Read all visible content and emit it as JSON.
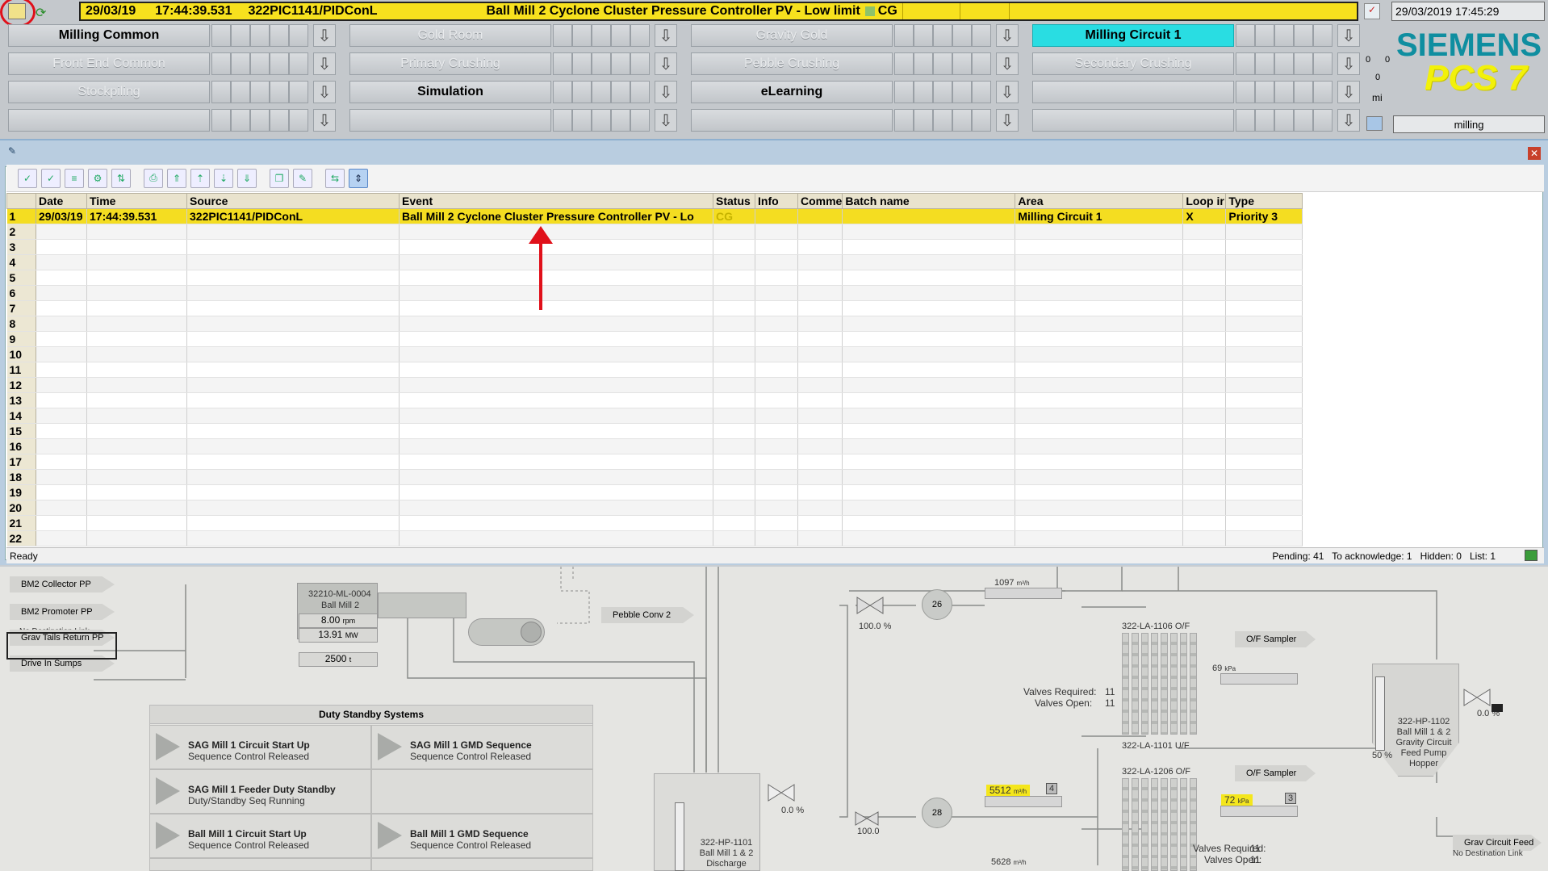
{
  "topbar": {
    "alarm": {
      "date": "29/03/19",
      "time": "17:44:39.531",
      "source": "322PIC1141/PIDConL",
      "event": "Ball Mill 2 Cyclone Cluster Pressure Controller PV - Low limit",
      "status": "CG"
    },
    "datetime": "29/03/2019 17:45:29",
    "area": "milling",
    "brand": "SIEMENS",
    "product": "PCS 7",
    "nav_row1": [
      "Milling Common",
      "Gold Room",
      "Gravity Gold",
      "Milling Circuit 1"
    ],
    "nav_row2": [
      "Front End Common",
      "Primary Crushing",
      "Pebble Crushing",
      "Secondary Crushing"
    ],
    "nav_row3": [
      "Stockpiling",
      "Simulation",
      "eLearning",
      ""
    ],
    "nav_row4": [
      "",
      "",
      "",
      ""
    ],
    "side_counts": {
      "a": "0",
      "b": "0",
      "c": "0",
      "d": "mi"
    }
  },
  "alarm_list": {
    "columns": [
      "Date",
      "Time",
      "Source",
      "Event",
      "Status",
      "Info",
      "Comme",
      "Batch name",
      "Area",
      "Loop ir",
      "Type"
    ],
    "rows": [
      {
        "n": "1",
        "date": "29/03/19",
        "time": "17:44:39.531",
        "source": "322PIC1141/PIDConL",
        "event": "Ball Mill 2 Cyclone Cluster Pressure Controller PV - Lo",
        "status": "CG",
        "info": "",
        "comment": "",
        "batch": "",
        "area": "Milling Circuit 1",
        "loop": "X",
        "type": "Priority 3"
      }
    ],
    "row_numbers": [
      "2",
      "3",
      "4",
      "5",
      "6",
      "7",
      "8",
      "9",
      "10",
      "11",
      "12",
      "13",
      "14",
      "15",
      "16",
      "17",
      "18",
      "19",
      "20",
      "21",
      "22"
    ],
    "status": "Ready",
    "counts": "Pending: 41   To acknowledge: 1   Hidden: 0   List: 1"
  },
  "plant": {
    "tags": [
      "BM2 Collector PP",
      "BM2 Promoter PP",
      "No Destination Link",
      "Grav Tails Return PP",
      "Drive In Sumps",
      "Pebble Conv 2",
      "O/F Sampler",
      "O/F Sampler",
      "Grav Circuit Feed",
      "No Destination Link"
    ],
    "mill": {
      "id": "32210-ML-0004",
      "name": "Ball Mill 2",
      "speed": "8.00",
      "speed_unit": "rpm",
      "power": "13.91",
      "power_unit": "MW",
      "weight": "2500",
      "weight_unit": "t"
    },
    "duty_title": "Duty Standby Systems",
    "duty": [
      {
        "t": "SAG Mill 1 Circuit Start Up",
        "s": "Sequence Control Released"
      },
      {
        "t": "SAG Mill 1 GMD Sequence",
        "s": "Sequence Control Released"
      },
      {
        "t": "SAG Mill 1 Feeder Duty Standby",
        "s": "Duty/Standby Seq Running"
      },
      {
        "t": "Ball Mill 1 Circuit Start Up",
        "s": "Sequence Control Released"
      },
      {
        "t": "Ball Mill 1 GMD Sequence",
        "s": "Sequence Control Released"
      }
    ],
    "flow1": "1097",
    "flow_unit": "m³/h",
    "flow2": "5512",
    "flow2_badge": "4",
    "flow3": "5628",
    "press1": "69",
    "press_unit": "kPa",
    "press2": "72",
    "press2_badge": "3",
    "valve1": "100.0 %",
    "valve2": "0.0 %",
    "valve3": "100.0",
    "valve4": "0.0 %",
    "pump1": "26",
    "pump2": "28",
    "la1": "322-LA-1106 O/F",
    "la2": "322-LA-1101 U/F",
    "la3": "322-LA-1206 O/F",
    "valves_required_label": "Valves Required:",
    "valves_required": "11",
    "valves_open_label": "Valves Open:",
    "valves_open": "11",
    "hopper1": "322-HP-1101 Ball Mill 1 & 2 Discharge",
    "hopper2": "322-HP-1102 Ball Mill 1 & 2 Gravity Circuit Feed Pump Hopper",
    "hopper2_level": "50 %"
  },
  "colors": {
    "alarm": "#f4dd21",
    "active_nav": "#29dde2",
    "brand": "#0f8ea0",
    "product": "#f2f10a",
    "annotation": "#e0101a"
  }
}
